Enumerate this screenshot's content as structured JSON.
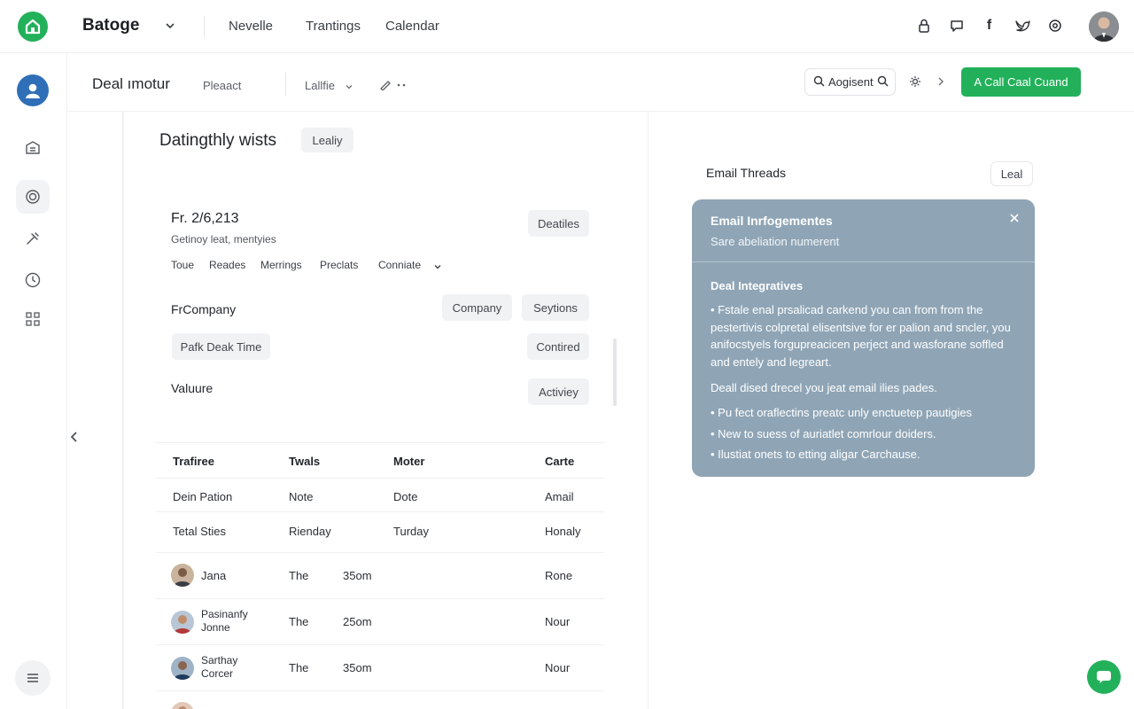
{
  "topbar": {
    "brand": "Batoge",
    "nav": [
      "Nevelle",
      "Trantings",
      "Calendar"
    ]
  },
  "subheader": {
    "title": "Deal ımotur",
    "filter": "Pleaact",
    "dropdown": "Lallfie",
    "search_value": "Aogisent",
    "cta_label": "A Call Caal Cuand"
  },
  "deals": {
    "section_title": "Datingthly wists",
    "section_pill": "Lealiy",
    "date": "Fr. 2/6,213",
    "subtitle": "Getinoy leat, mentyies",
    "details_button": "Deatiles",
    "tabs": [
      "Toue",
      "Reades",
      "Merrings",
      "Preclats",
      "Conniate"
    ],
    "company_label": "FrCompany",
    "company_button": "Company",
    "sections_button": "Seytions",
    "peak_pill": "Pafk Deak Time",
    "control_button": "Contired",
    "value_label": "Valuure",
    "activity_button": "Activiey"
  },
  "table": {
    "headers": [
      "Trafiree",
      "Twals",
      "Moter",
      "Carte"
    ],
    "rows": [
      {
        "c1": "Dein Pation",
        "c2": "Note",
        "c3": "Dote",
        "c4": "Amail"
      },
      {
        "c1": "Tetal Sties",
        "c2": "Rienday",
        "c3": "Turday",
        "c4": "Honaly"
      }
    ],
    "people": [
      {
        "name": "Jana",
        "type": "The",
        "time": "35om",
        "status": "Rone"
      },
      {
        "name": "Pasinanfy Jonne",
        "type": "The",
        "time": "25om",
        "status": "Nour"
      },
      {
        "name": "Sarthay Corcer",
        "type": "The",
        "time": "35om",
        "status": "Nour"
      }
    ]
  },
  "threads": {
    "label": "Email Threads",
    "button": "Leal",
    "panel": {
      "title": "Email Inrfogementes",
      "subtitle": "Sare abeliation numerent",
      "heading": "Deal Integratives",
      "paragraph": "• Fstale enal prsalicad carkend you can from from the pestertivis colpretal elisentsive for er palion and sncler, you anifocstyels forgupreacicen perject and wasforane soffled and entely and legreart.",
      "line2": "Deall dised drecel you jeat email ilies pades.",
      "bullets": [
        "• Pu fect oraflectins preatc unly enctuetep pautigies",
        "• New to suess of auriatlet comrlour doiders.",
        "• Ilustiat onets to etting aligar Carchause."
      ]
    }
  },
  "colors": {
    "accent": "#22b15a",
    "panel": "#8fa5b6"
  }
}
